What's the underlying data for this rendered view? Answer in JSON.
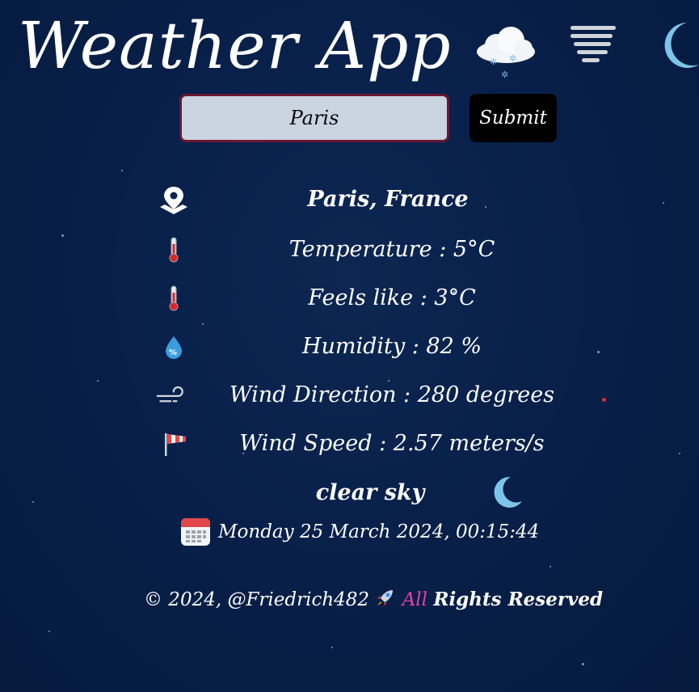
{
  "header": {
    "title": "Weather App",
    "icons": [
      "snow-cloud-icon",
      "fog-icon",
      "moon-icon"
    ]
  },
  "search": {
    "value": "Paris",
    "submit_label": "Submit"
  },
  "location": {
    "text": "Paris, France",
    "icon": "location-pin-icon"
  },
  "details": [
    {
      "icon": "thermometer-icon",
      "text": "Temperature : 5°C"
    },
    {
      "icon": "thermometer-icon",
      "text": "Feels like : 3°C"
    },
    {
      "icon": "humidity-drop-icon",
      "text": "Humidity : 82 %"
    },
    {
      "icon": "wind-icon",
      "text": "Wind Direction : 280 degrees"
    },
    {
      "icon": "windsock-icon",
      "text": "Wind Speed : 2.57 meters/s"
    }
  ],
  "condition": {
    "text": "clear sky",
    "icon": "moon-icon"
  },
  "datetime": {
    "text": "Monday 25 March 2024, 00:15:44",
    "icon": "calendar-icon"
  },
  "footer": {
    "copyright": "© 2024, @Friedrich482",
    "icon": "rocket-icon",
    "all": "All",
    "rights": "Rights Reserved"
  },
  "colors": {
    "background": "#08204a",
    "input_bg": "#cbd5e1",
    "input_border": "#6b1733",
    "button_bg": "#000000",
    "moon": "#7cc4ea",
    "accent_pink": "#e53fa8",
    "red_dot": "#e02a3a"
  }
}
